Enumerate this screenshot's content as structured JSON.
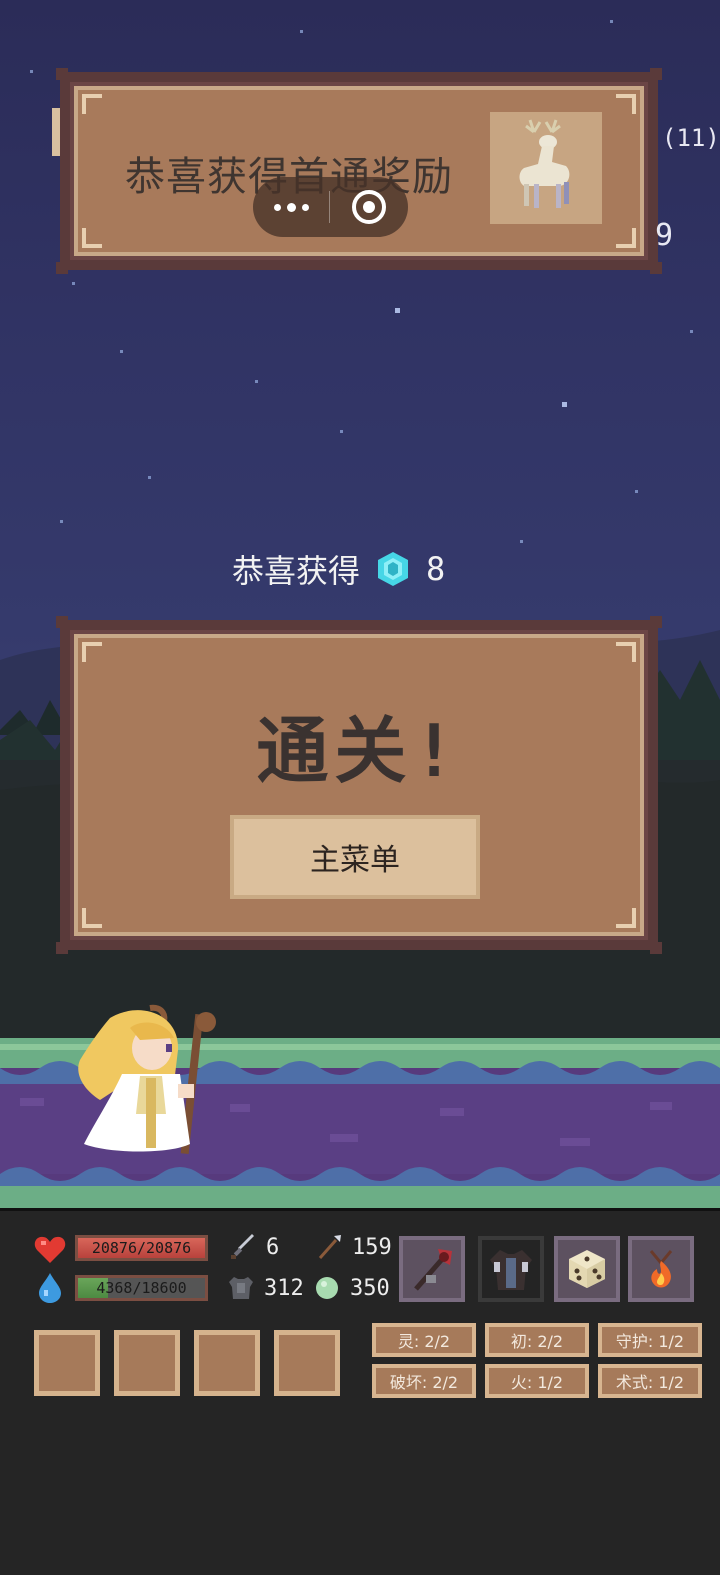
{
  "reward_banner": {
    "text": "恭喜获得首通奖励",
    "reward_icon": "white-deer-icon"
  },
  "mini_program_capsule": {
    "more_icon": "more-dots-icon",
    "close_icon": "record-circle-icon"
  },
  "peek_text": {
    "right_top": "(11)",
    "right_mid": "9"
  },
  "gain": {
    "label": "恭喜获得",
    "gem_icon": "cyan-gem-icon",
    "amount": "8"
  },
  "clear_dialog": {
    "title": "通关!",
    "button_label": "主菜单"
  },
  "hud": {
    "hp": {
      "text": "20876/20876",
      "current": 20876,
      "max": 20876
    },
    "mp": {
      "text": "4368/18600",
      "current": 4368,
      "max": 18600
    },
    "stats": [
      {
        "icon": "sword-icon",
        "value": "6"
      },
      {
        "icon": "spear-icon",
        "value": "159"
      },
      {
        "icon": "armor-icon",
        "value": "312"
      },
      {
        "icon": "green-orb-icon",
        "value": "350"
      }
    ],
    "equipment": [
      "crimson-staff-icon",
      "dark-robe-icon",
      "dice-icon",
      "fire-amulet-icon"
    ],
    "tags": [
      {
        "label": "灵: 2/2"
      },
      {
        "label": "初: 2/2"
      },
      {
        "label": "守护: 1/2"
      },
      {
        "label": "破坏: 2/2"
      },
      {
        "label": "火: 1/2"
      },
      {
        "label": "术式: 1/2"
      }
    ]
  },
  "colors": {
    "panel": "#a87a5b",
    "panel_border": "#5a3a3a",
    "hp": "#c4504a",
    "mp": "#5a9a4c",
    "gem": "#46d6e6",
    "hud_bg": "#252525"
  }
}
